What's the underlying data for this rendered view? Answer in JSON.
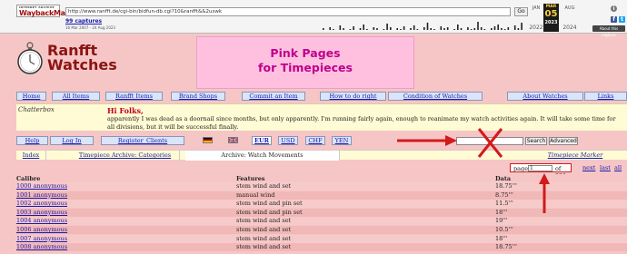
{
  "wayback": {
    "logo_top": "INTERNET ARCHIVE",
    "logo_main": "WaybackMachine",
    "url": "http://www.ranfft.de/cgi-bin/bidfun-db.cgi?10&ranfft&&2uswk",
    "go_label": "Go",
    "captures": "99 captures",
    "range": "16 Mar 2007 - 24 Aug 2023",
    "months": [
      "JAN",
      "MAR",
      "AUG"
    ],
    "years": [
      "2022",
      "2023",
      "2024"
    ],
    "current": {
      "month": "MAR",
      "day": "05",
      "year": "2023"
    },
    "about_label": "About this capture"
  },
  "site": {
    "name_line1": "Ranfft",
    "name_line2": "Watches",
    "banner_line1": "Pink Pages",
    "banner_line2": "for Timepieces"
  },
  "nav": [
    "Home",
    "All Items",
    "Ranfft Items",
    "Brand Shops",
    "Commit an Item",
    "How to do right",
    "Condition of Watches",
    "About Watches",
    "Links"
  ],
  "chatterbox": {
    "label": "Chatterbox",
    "title": "Hi Folks,",
    "text": "apparently I was dead as a doornail since months, but only apparently. I'm running fairly again, enough to reanimate my watch activities again. It will take some time for all divisions, but it will be successful finally."
  },
  "bar2": {
    "help": "Help",
    "login": "Log In",
    "register": "Register_Clients",
    "currencies": [
      "EUR",
      "USD",
      "CHF",
      "YEN"
    ],
    "search_button": "Search",
    "advanced_button": "Advanced"
  },
  "tabs": {
    "index": "Index",
    "categories": "Timepiece Archive: Categories",
    "movements": "Archive: Watch Movements",
    "marker": "Timepiece Marker"
  },
  "pager": {
    "label": "page",
    "value": "1",
    "of": "of 221",
    "next": "next",
    "last": "last",
    "all": "all"
  },
  "table": {
    "headers": [
      "Calibre",
      "Features",
      "Data"
    ],
    "rows": [
      {
        "calibre": "1000 anonymous",
        "features": "stem wind and set",
        "data": "18.75'''"
      },
      {
        "calibre": "1001 anonymous",
        "features": "manual wind",
        "data": "8.75'''"
      },
      {
        "calibre": "1002 anonymous",
        "features": "stem wind and pin set",
        "data": "11.5'''"
      },
      {
        "calibre": "1003 anonymous",
        "features": "stem wind and pin set",
        "data": "18'''"
      },
      {
        "calibre": "1004 anonymous",
        "features": "stem wind and set",
        "data": "19'''"
      },
      {
        "calibre": "1006 anonymous",
        "features": "stem wind and set",
        "data": "10.5'''"
      },
      {
        "calibre": "1007 anonymous",
        "features": "stem wind and set",
        "data": "18'''"
      },
      {
        "calibre": "1008 anonymous",
        "features": "stem wind and set",
        "data": "18.75'''"
      }
    ]
  },
  "colors": {
    "page_bg": "#f6c6c6",
    "banner_bg": "#ffc0e0",
    "banner_text": "#c0008a",
    "brand_red": "#8b1414",
    "link": "#1a1aaa",
    "annotation_red": "#d21a1a"
  },
  "icons": [
    "watch-logo-icon",
    "flag-de-icon",
    "flag-uk-icon",
    "info-icon",
    "facebook-icon",
    "twitter-icon",
    "red-arrow-icon",
    "red-x-icon"
  ]
}
